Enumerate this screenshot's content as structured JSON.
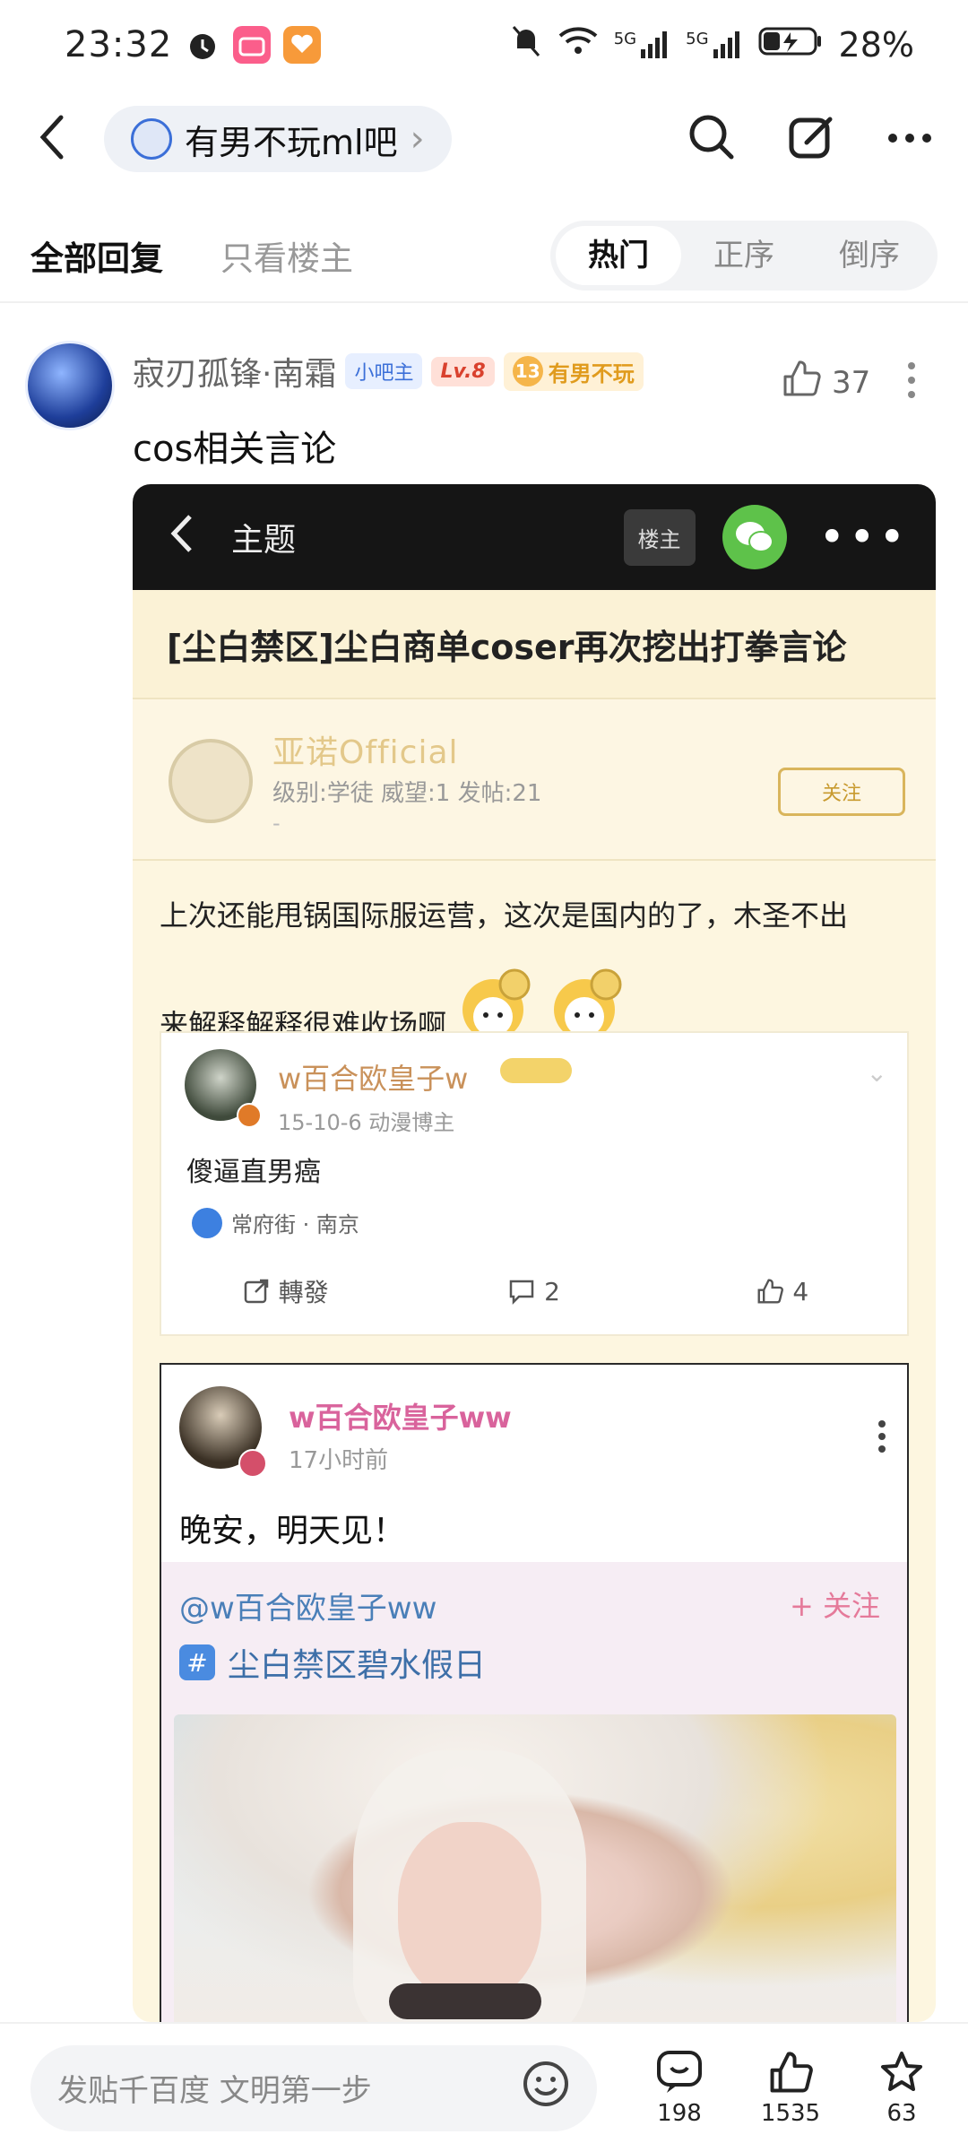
{
  "status_bar": {
    "time": "23:32",
    "battery": "28%",
    "network": [
      "5G",
      "5G"
    ]
  },
  "nav": {
    "forum_name": "有男不玩ml吧",
    "forum_chevron": "›"
  },
  "tabs": {
    "all_replies": "全部回复",
    "owner_only": "只看楼主",
    "sort": [
      "热门",
      "正序",
      "倒序"
    ]
  },
  "post": {
    "author": "寂刃孤锋·南霜",
    "badge_mod": "小吧主",
    "badge_level": "Lv.8",
    "fan_level": "13",
    "fan_title": "有男不玩",
    "likes": "37",
    "text": "cos相关言论"
  },
  "embed": {
    "topbar_title": "主题",
    "owner_label": "楼主",
    "dots": "•••",
    "headline": "[尘白禁区]尘白商单coser再次挖出打拳言论",
    "poster_name": "亚诺Official",
    "poster_meta": "级别:学徒 威望:1 发帖:21",
    "poster_dash": "-",
    "follow_label": "关注",
    "body_line1": "上次还能甩锅国际服运营，这次是国内的了，木圣不出",
    "body_line2": "来解释解释很难收场啊",
    "card1": {
      "name": "w百合欧皇子w",
      "meta": "15-10-6  动漫博主",
      "text": "傻逼直男癌",
      "location": "常府街 · 南京",
      "repost": "轉發",
      "comments": "2",
      "likes": "4",
      "chevron": "⌄"
    },
    "card2": {
      "name": "w百合欧皇子ww",
      "time": "17小时前",
      "text": "晚安，明天见！",
      "mention": "@w百合欧皇子ww",
      "follow": "+ 关注",
      "topic": "尘白禁区碧水假日",
      "hash": "#"
    }
  },
  "bottom": {
    "placeholder": "发贴千百度 文明第一步",
    "comments": "198",
    "likes": "1535",
    "stars": "63"
  },
  "colors": {
    "accent_blue": "#3b6fd8",
    "level_red": "#d9412e",
    "fan_gold": "#e09b1d"
  }
}
